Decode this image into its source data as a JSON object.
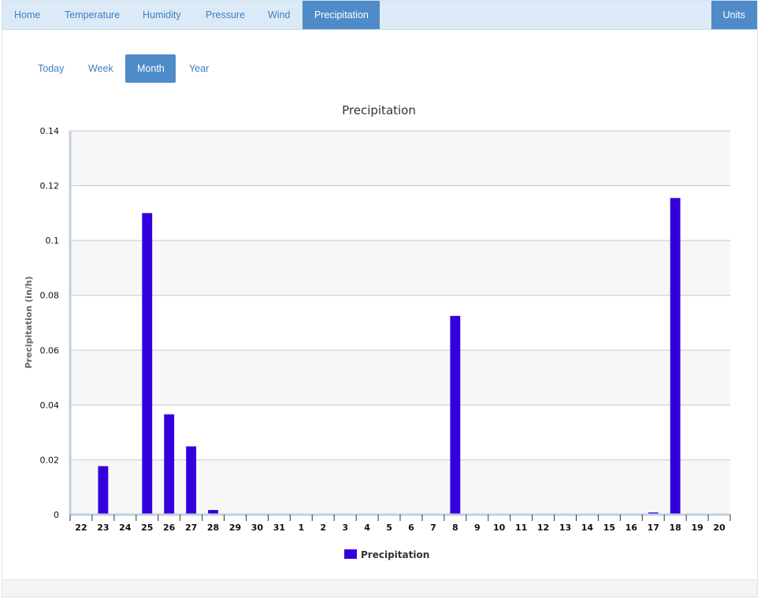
{
  "nav": {
    "items": [
      {
        "label": "Home",
        "active": false
      },
      {
        "label": "Temperature",
        "active": false
      },
      {
        "label": "Humidity",
        "active": false
      },
      {
        "label": "Pressure",
        "active": false
      },
      {
        "label": "Wind",
        "active": false
      },
      {
        "label": "Precipitation",
        "active": true
      }
    ],
    "units_label": "Units"
  },
  "range_tabs": [
    {
      "label": "Today",
      "active": false
    },
    {
      "label": "Week",
      "active": false
    },
    {
      "label": "Month",
      "active": true
    },
    {
      "label": "Year",
      "active": false
    }
  ],
  "colors": {
    "accent": "#4f8bc8",
    "nav_bg": "#dbeaf6",
    "link": "#3e7fc1",
    "bar": "#3300dd"
  },
  "chart_data": {
    "type": "bar",
    "title": "Precipitation",
    "ylabel": "Precipitation (in/h)",
    "xlabel": "",
    "ylim": [
      0,
      0.14
    ],
    "yticks": [
      "0",
      "0.02",
      "0.04",
      "0.06",
      "0.08",
      "0.1",
      "0.12",
      "0.14"
    ],
    "grid": true,
    "legend_position": "bottom-center",
    "categories": [
      "22",
      "23",
      "24",
      "25",
      "26",
      "27",
      "28",
      "29",
      "30",
      "31",
      "1",
      "2",
      "3",
      "4",
      "5",
      "6",
      "7",
      "8",
      "9",
      "10",
      "11",
      "12",
      "13",
      "14",
      "15",
      "16",
      "17",
      "18",
      "19",
      "20"
    ],
    "series": [
      {
        "name": "Precipitation",
        "color": "#3300dd",
        "values": [
          0,
          0.0177,
          0,
          0.11,
          0.0366,
          0.0249,
          0.0017,
          0,
          0,
          0,
          0,
          0,
          0,
          0,
          0,
          0,
          0,
          0.0725,
          0,
          0,
          0,
          0,
          0,
          0,
          0,
          0,
          0.0008,
          0.1155,
          0,
          0
        ]
      }
    ]
  }
}
